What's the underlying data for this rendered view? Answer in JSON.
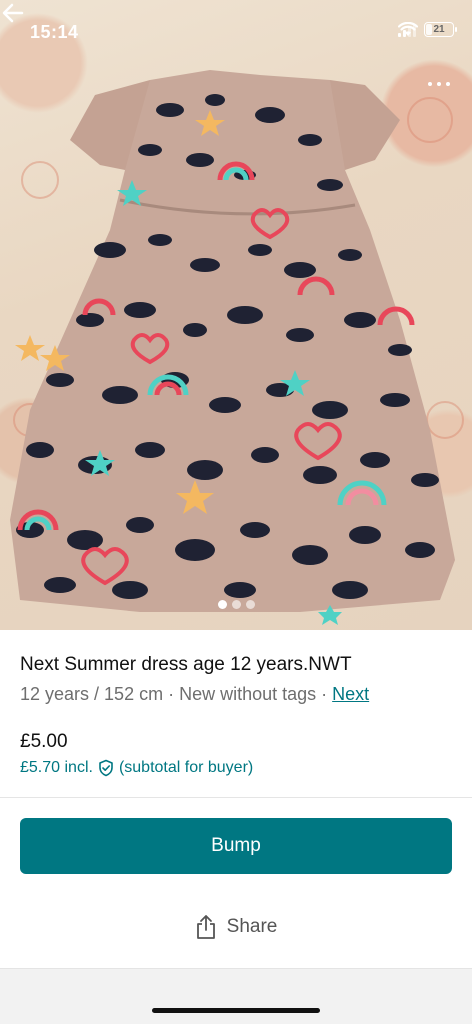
{
  "status_bar": {
    "time": "15:14",
    "battery": "21"
  },
  "gallery": {
    "page_count": 3,
    "active_index": 0
  },
  "listing": {
    "title": "Next Summer dress age 12 years.NWT",
    "size": "12 years / 152 cm",
    "sep1": " · ",
    "condition": "New without tags",
    "sep2": " · ",
    "brand": "Next",
    "price": "£5.00",
    "price_incl": "£5.70 incl.",
    "price_incl_note": "(subtotal for buyer)"
  },
  "actions": {
    "bump_label": "Bump",
    "share_label": "Share"
  },
  "colors": {
    "accent": "#007782",
    "text": "#111111",
    "muted": "#6e6e6e"
  },
  "icons": [
    "back-arrow-icon",
    "more-icon",
    "shield-check-icon",
    "share-icon",
    "wifi-icon",
    "battery-icon"
  ]
}
